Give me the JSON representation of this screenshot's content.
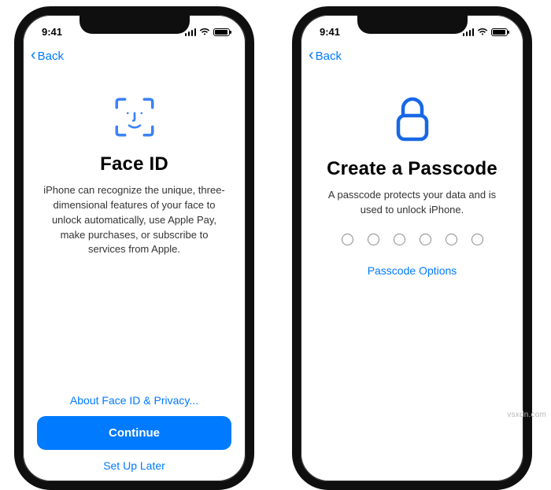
{
  "status": {
    "time": "9:41"
  },
  "nav": {
    "back": "Back"
  },
  "left": {
    "title": "Face ID",
    "desc": "iPhone can recognize the unique, three-dimensional features of your face to unlock automatically, use Apple Pay, make purchases, or subscribe to services from Apple.",
    "about_link": "About Face ID & Privacy...",
    "continue": "Continue",
    "setup_later": "Set Up Later"
  },
  "right": {
    "title": "Create a Passcode",
    "desc": "A passcode protects your data and is used to unlock iPhone.",
    "options": "Passcode Options"
  },
  "watermark": "vsxdn.com",
  "colors": {
    "accent": "#007aff"
  }
}
